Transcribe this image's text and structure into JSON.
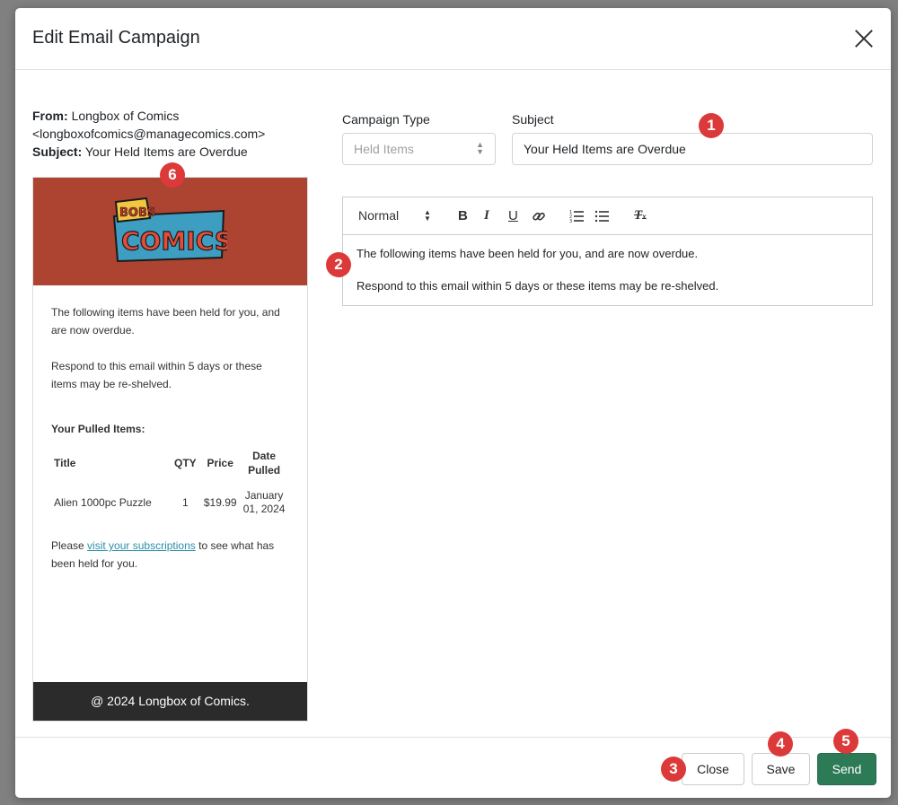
{
  "modal": {
    "title": "Edit Email Campaign"
  },
  "preview_meta": {
    "from_label": "From:",
    "from_value": "Longbox of Comics <longboxofcomics@managecomics.com>",
    "subject_label": "Subject:",
    "subject_value": "Your Held Items are Overdue"
  },
  "email_preview": {
    "logo_top": "BOBS",
    "logo_main": "COMICS",
    "para1": "The following items have been held for you, and are now overdue.",
    "para2": "Respond to this email within 5 days or these items may be re-shelved.",
    "items_heading": "Your Pulled Items:",
    "table": {
      "headers": [
        "Title",
        "QTY",
        "Price",
        "Date Pulled"
      ],
      "rows": [
        [
          "Alien 1000pc Puzzle",
          "1",
          "$19.99",
          "January 01, 2024"
        ]
      ]
    },
    "closing_prefix": "Please",
    "closing_link": "visit your subscriptions",
    "closing_suffix": "to see what has been held for you.",
    "footer": "@ 2024 Longbox of Comics."
  },
  "form": {
    "campaign_type_label": "Campaign Type",
    "campaign_type_value": "Held Items",
    "subject_label": "Subject",
    "subject_value": "Your Held Items are Overdue"
  },
  "editor": {
    "format_select": "Normal",
    "toolbar_icons": [
      "bold-icon",
      "italic-icon",
      "underline-icon",
      "link-icon",
      "ordered-list-icon",
      "bullet-list-icon",
      "clear-format-icon"
    ],
    "line1": "The following items have been held for you, and are now overdue.",
    "line2": "Respond to this email within 5 days or these items may be re-shelved."
  },
  "footer_buttons": {
    "close": "Close",
    "save": "Save",
    "send": "Send"
  },
  "badges": [
    "1",
    "2",
    "3",
    "4",
    "5",
    "6"
  ],
  "colors": {
    "banner": "#ad4331",
    "send_button": "#2d7a57",
    "badge": "#dc3a3a",
    "link": "#2c8fa8"
  }
}
